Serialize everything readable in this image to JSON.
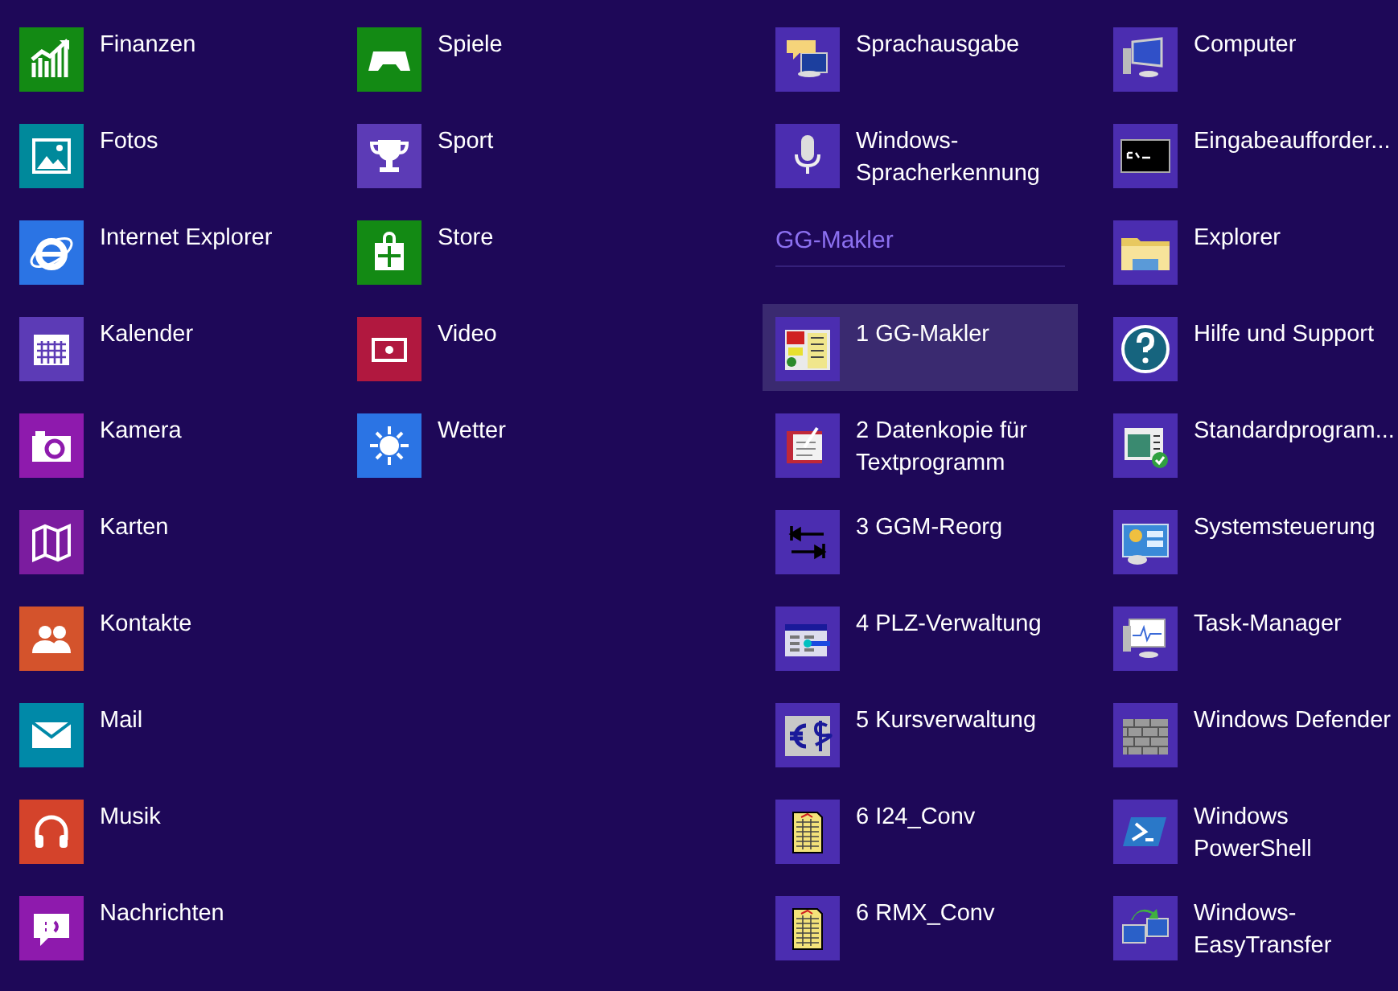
{
  "columns": [
    {
      "items": [
        {
          "kind": "app",
          "label": "Finanzen",
          "color": "#138a14",
          "selected": false
        },
        {
          "kind": "app",
          "label": "Fotos",
          "color": "#00899b",
          "selected": false
        },
        {
          "kind": "app",
          "label": "Internet Explorer",
          "color": "#2b74e4",
          "selected": false
        },
        {
          "kind": "app",
          "label": "Kalender",
          "color": "#5c3bb6",
          "selected": false
        },
        {
          "kind": "app",
          "label": "Kamera",
          "color": "#8e1aad",
          "selected": false
        },
        {
          "kind": "app",
          "label": "Karten",
          "color": "#7b1c9f",
          "selected": false
        },
        {
          "kind": "app",
          "label": "Kontakte",
          "color": "#d4532c",
          "selected": false
        },
        {
          "kind": "app",
          "label": "Mail",
          "color": "#0089a8",
          "selected": false
        },
        {
          "kind": "app",
          "label": "Musik",
          "color": "#d4432b",
          "selected": false
        },
        {
          "kind": "app",
          "label": "Nachrichten",
          "color": "#8e1aad",
          "selected": false
        }
      ]
    },
    {
      "items": [
        {
          "kind": "app",
          "label": "Spiele",
          "color": "#138a14",
          "selected": false
        },
        {
          "kind": "app",
          "label": "Sport",
          "color": "#5c3bb6",
          "selected": false
        },
        {
          "kind": "app",
          "label": "Store",
          "color": "#138a14",
          "selected": false
        },
        {
          "kind": "app",
          "label": "Video",
          "color": "#b1183f",
          "selected": false
        },
        {
          "kind": "app",
          "label": "Wetter",
          "color": "#2b74e4",
          "selected": false
        }
      ]
    },
    {
      "items": [
        {
          "kind": "app",
          "label": "Sprachausgabe",
          "color": "#4b2db0",
          "selected": false
        },
        {
          "kind": "app",
          "label": "Windows-\nSpracherkennung",
          "color": "#4b2db0",
          "selected": false
        },
        {
          "kind": "header",
          "label": "GG-Makler"
        },
        {
          "kind": "app",
          "label": "1 GG-Makler",
          "color": "#4b2db0",
          "selected": true
        },
        {
          "kind": "app",
          "label": "2 Datenkopie für\nTextprogramm",
          "color": "#4b2db0",
          "selected": false
        },
        {
          "kind": "app",
          "label": "3 GGM-Reorg",
          "color": "#4b2db0",
          "selected": false
        },
        {
          "kind": "app",
          "label": "4 PLZ-Verwaltung",
          "color": "#4b2db0",
          "selected": false
        },
        {
          "kind": "app",
          "label": "5 Kursverwaltung",
          "color": "#4b2db0",
          "selected": false
        },
        {
          "kind": "app",
          "label": "6 I24_Conv",
          "color": "#4b2db0",
          "selected": false
        },
        {
          "kind": "app",
          "label": "6 RMX_Conv",
          "color": "#4b2db0",
          "selected": false
        }
      ]
    },
    {
      "items": [
        {
          "kind": "app",
          "label": "Computer",
          "color": "#4b2db0",
          "selected": false
        },
        {
          "kind": "app",
          "label": "Eingabeaufforder...",
          "color": "#4b2db0",
          "selected": false
        },
        {
          "kind": "app",
          "label": "Explorer",
          "color": "#4b2db0",
          "selected": false
        },
        {
          "kind": "app",
          "label": "Hilfe und Support",
          "color": "#4b2db0",
          "selected": false
        },
        {
          "kind": "app",
          "label": "Standardprogram...",
          "color": "#4b2db0",
          "selected": false
        },
        {
          "kind": "app",
          "label": "Systemsteuerung",
          "color": "#4b2db0",
          "selected": false
        },
        {
          "kind": "app",
          "label": "Task-Manager",
          "color": "#4b2db0",
          "selected": false
        },
        {
          "kind": "app",
          "label": "Windows Defender",
          "color": "#4b2db0",
          "selected": false
        },
        {
          "kind": "app",
          "label": "Windows\nPowerShell",
          "color": "#4b2db0",
          "selected": false
        },
        {
          "kind": "app",
          "label": "Windows-\nEasyTransfer",
          "color": "#4b2db0",
          "selected": false
        }
      ]
    }
  ]
}
